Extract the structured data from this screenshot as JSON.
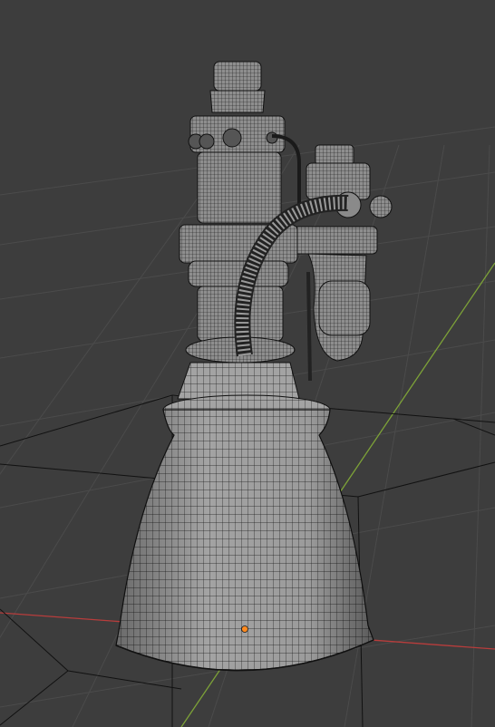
{
  "viewport": {
    "mode": "wireframe",
    "background_color": "#3d3d3d",
    "grid_color": "#4a4a4a",
    "x_axis_color": "#c2403f",
    "y_axis_color": "#7fa33a",
    "wire_color": "#111111",
    "surface_color": "#9c9c9c"
  },
  "scene": {
    "object": "rocket-engine",
    "origin_color": "#ff8a1f",
    "objects": [
      "nozzle-bell",
      "combustion-chamber",
      "injector-dome",
      "turbopump",
      "feed-pipe",
      "turbine-exhaust"
    ]
  }
}
